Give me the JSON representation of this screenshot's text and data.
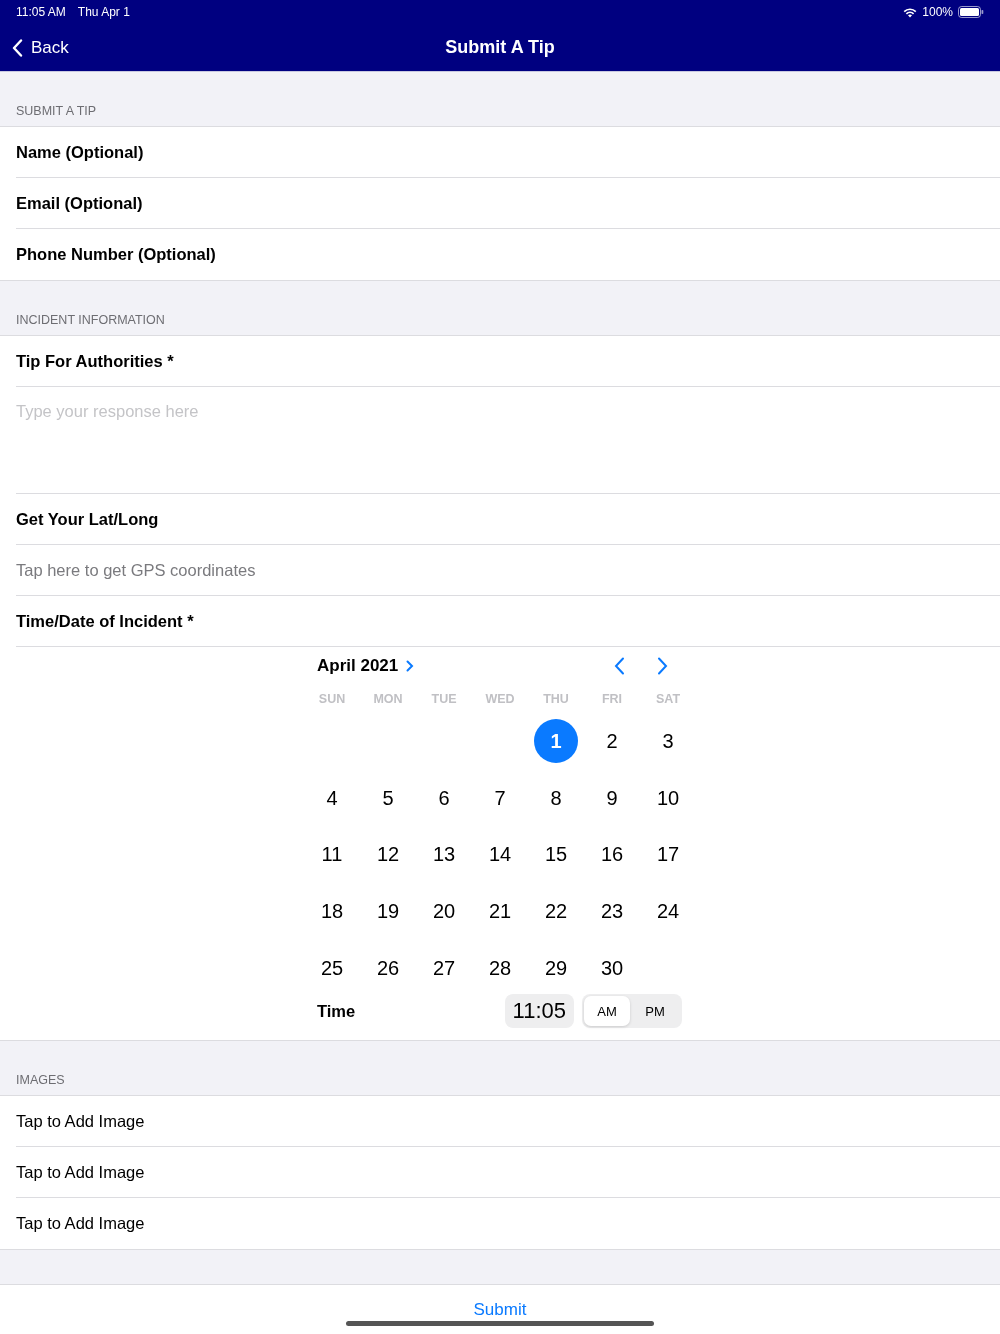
{
  "status_bar": {
    "time": "11:05 AM",
    "date": "Thu Apr 1",
    "battery": "100%"
  },
  "nav": {
    "back": "Back",
    "title": "Submit A Tip"
  },
  "contact_section": {
    "header": "SUBMIT A TIP",
    "fields": [
      {
        "label": "Name (Optional)"
      },
      {
        "label": "Email (Optional)"
      },
      {
        "label": "Phone Number (Optional)"
      }
    ]
  },
  "incident_section": {
    "header": "INCIDENT INFORMATION",
    "tip": {
      "label": "Tip For Authorities *",
      "placeholder": "Type your response here"
    },
    "location": {
      "label": "Get Your Lat/Long",
      "action": "Tap here to get GPS coordinates"
    },
    "datetime": {
      "label": "Time/Date of Incident *",
      "calendar": {
        "month": "April 2021",
        "weekdays": [
          "SUN",
          "MON",
          "TUE",
          "WED",
          "THU",
          "FRI",
          "SAT"
        ],
        "weeks": [
          {
            "days": [
              {
                "label": "1",
                "selected": true
              },
              {
                "label": "2",
                "selected": false
              },
              {
                "label": "3",
                "selected": false
              }
            ]
          },
          {
            "days": [
              {
                "label": "4",
                "selected": false
              },
              {
                "label": "5",
                "selected": false
              },
              {
                "label": "6",
                "selected": false
              },
              {
                "label": "7",
                "selected": false
              },
              {
                "label": "8",
                "selected": false
              },
              {
                "label": "9",
                "selected": false
              },
              {
                "label": "10",
                "selected": false
              }
            ]
          },
          {
            "days": [
              {
                "label": "11",
                "selected": false
              },
              {
                "label": "12",
                "selected": false
              },
              {
                "label": "13",
                "selected": false
              },
              {
                "label": "14",
                "selected": false
              },
              {
                "label": "15",
                "selected": false
              },
              {
                "label": "16",
                "selected": false
              },
              {
                "label": "17",
                "selected": false
              }
            ]
          },
          {
            "days": [
              {
                "label": "18",
                "selected": false
              },
              {
                "label": "19",
                "selected": false
              },
              {
                "label": "20",
                "selected": false
              },
              {
                "label": "21",
                "selected": false
              },
              {
                "label": "22",
                "selected": false
              },
              {
                "label": "23",
                "selected": false
              },
              {
                "label": "24",
                "selected": false
              }
            ]
          },
          {
            "days": [
              {
                "label": "25",
                "selected": false
              },
              {
                "label": "26",
                "selected": false
              },
              {
                "label": "27",
                "selected": false
              },
              {
                "label": "28",
                "selected": false
              },
              {
                "label": "29",
                "selected": false
              },
              {
                "label": "30",
                "selected": false
              }
            ]
          }
        ]
      },
      "time_label": "Time",
      "time": "11:05",
      "periods": [
        {
          "label": "AM",
          "selected": true
        },
        {
          "label": "PM",
          "selected": false
        }
      ]
    }
  },
  "images_section": {
    "header": "IMAGES",
    "items": [
      {
        "label": "Tap to Add Image"
      },
      {
        "label": "Tap to Add Image"
      },
      {
        "label": "Tap to Add Image"
      }
    ]
  },
  "submit": "Submit"
}
